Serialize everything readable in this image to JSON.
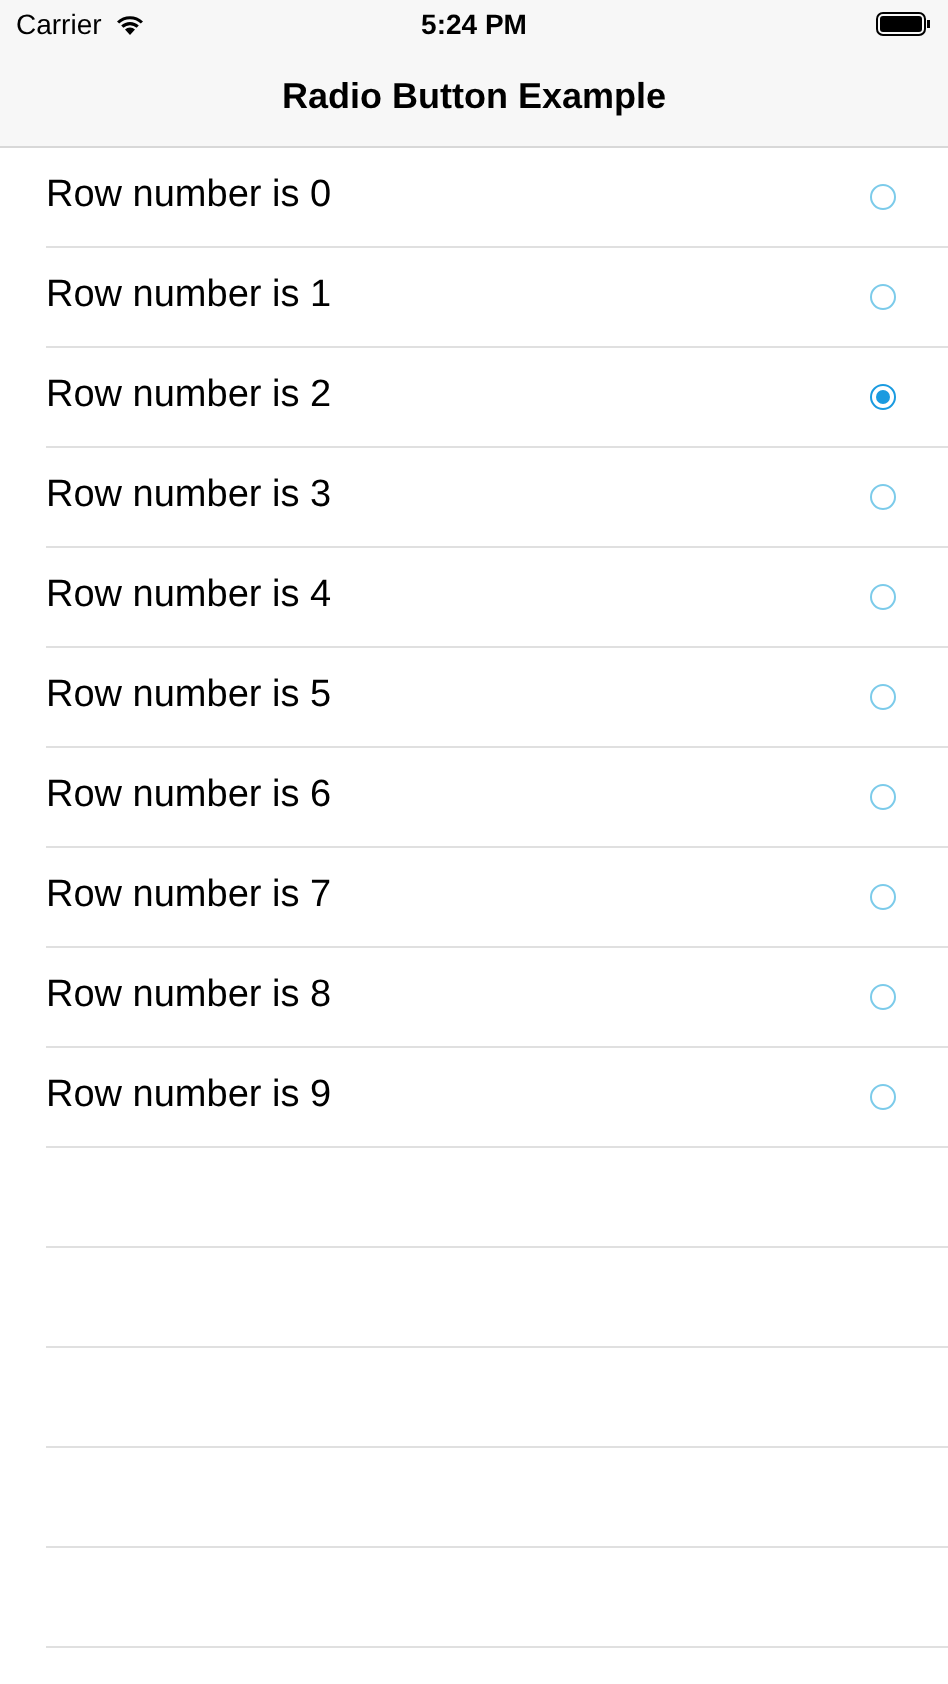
{
  "status_bar": {
    "carrier": "Carrier",
    "time": "5:24 PM"
  },
  "nav_bar": {
    "title": "Radio Button Example"
  },
  "rows": [
    {
      "label": "Row number is 0",
      "selected": false
    },
    {
      "label": "Row number is 1",
      "selected": false
    },
    {
      "label": "Row number is 2",
      "selected": true
    },
    {
      "label": "Row number is 3",
      "selected": false
    },
    {
      "label": "Row number is 4",
      "selected": false
    },
    {
      "label": "Row number is 5",
      "selected": false
    },
    {
      "label": "Row number is 6",
      "selected": false
    },
    {
      "label": "Row number is 7",
      "selected": false
    },
    {
      "label": "Row number is 8",
      "selected": false
    },
    {
      "label": "Row number is 9",
      "selected": false
    }
  ]
}
